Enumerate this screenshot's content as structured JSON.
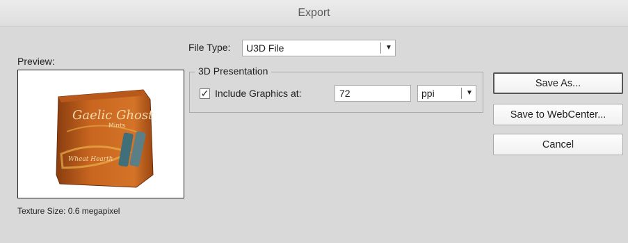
{
  "window": {
    "title": "Export"
  },
  "preview": {
    "label": "Preview:",
    "texture_size": "Texture Size: 0.6 megapixel",
    "product_image": {
      "brand_text": "Gaelic Ghost",
      "sub_text": "Mints",
      "bottom_text": "Wheat Hearth",
      "colors": {
        "bag": "#c8651f",
        "bag_dark": "#8a3d10",
        "accent": "#e9b04a"
      }
    }
  },
  "file_type": {
    "label": "File Type:",
    "selected": "U3D File",
    "arrow_icon": "triangle-down"
  },
  "presentation_3d": {
    "group_label": "3D Presentation",
    "include_graphics": {
      "checked": true,
      "label": "Include Graphics at:",
      "value": "72"
    },
    "unit": {
      "selected": "ppi",
      "arrow_icon": "triangle-down"
    }
  },
  "buttons": {
    "save_as": "Save As...",
    "save_to_webcenter": "Save to WebCenter...",
    "cancel": "Cancel"
  }
}
